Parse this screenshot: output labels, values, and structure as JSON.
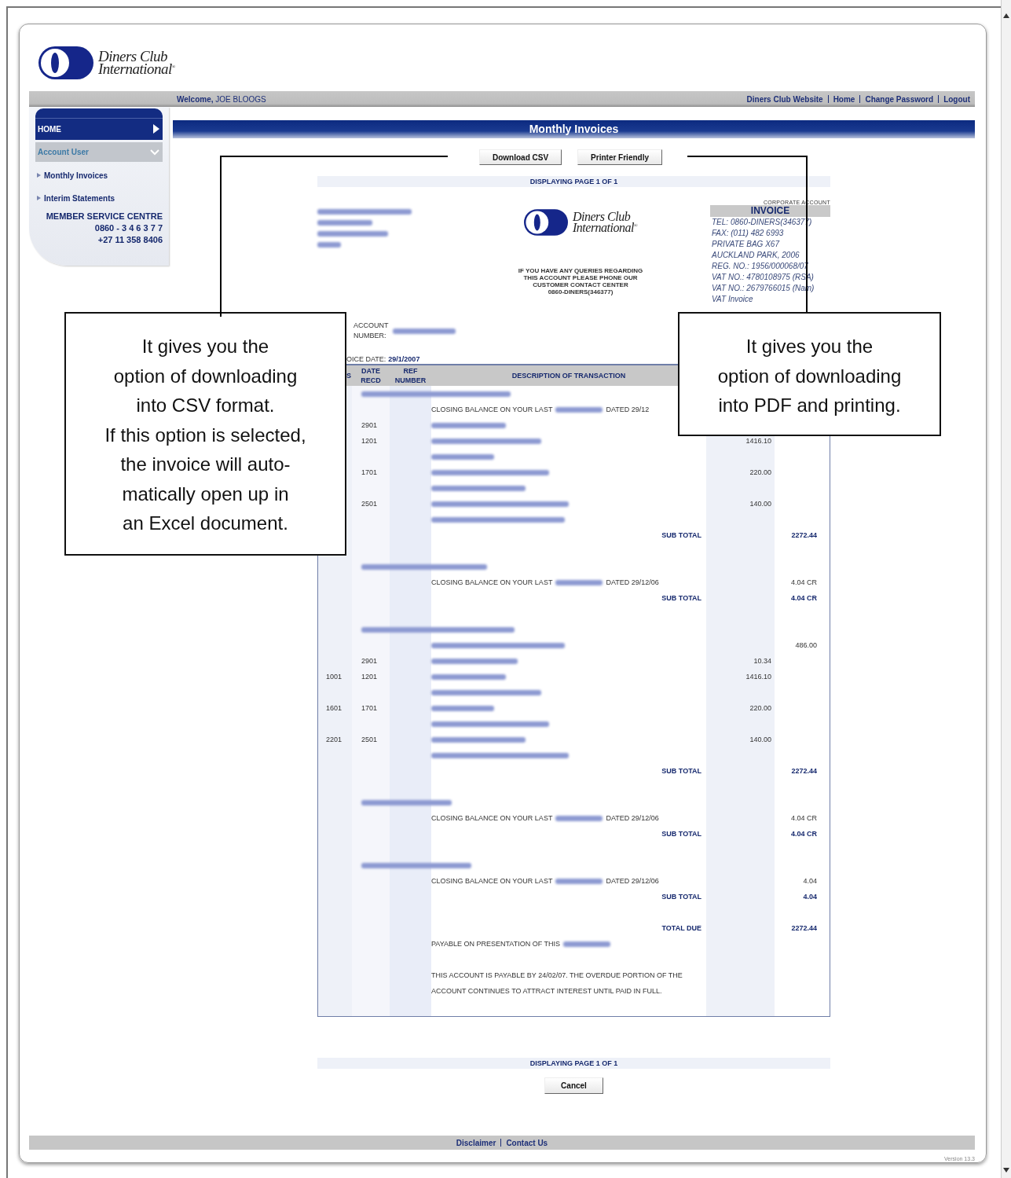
{
  "header": {
    "logo": {
      "line_1": "Diners Club",
      "line_2": "International$^{®}$"
    }
  },
  "top_bar": {
    "welcome": "**Welcome,** JOE BLOOGS",
    "links": [
      "Diners Club Website",
      "Home",
      "Change Password",
      "Logout"
    ]
  },
  "sidebar": {
    "items": [
      {
        "label": "HOME",
        "kind": "home"
      },
      {
        "label": "Account User",
        "kind": "section",
        "expanded": true
      },
      {
        "label": "Monthly Invoices",
        "kind": "link"
      },
      {
        "label": "Interim Statements",
        "kind": "link"
      }
    ],
    "service_centre": [
      "MEMBER SERVICE CENTRE",
      "0860 - 3 4 6 3 7 7",
      "+27 11 358 8406"
    ]
  },
  "page_title": "Monthly Invoices",
  "buttons": [
    "Download CSV",
    "Printer Friendly"
  ],
  "invoice": {
    "paging_top": "DISPLAYING PAGE 1 OF 1",
    "address": [
      {
        "kind": "redacted"
      },
      {
        "kind": "redacted"
      },
      {
        "kind": "redacted"
      },
      {
        "kind": "redacted"
      }
    ],
    "logo": {
      "line_1": "Diners Club",
      "line_2": "International$^{®}$"
    },
    "queries": [
      "IF YOU HAVE ANY QUERIES REGARDING",
      "THIS ACCOUNT PLEASE PHONE OUR",
      "CUSTOMER CONTACT CENTER",
      "0860-DINERS(346377)"
    ],
    "issuer": {
      "account_type": "CORPORATE ACCOUNT",
      "title": "INVOICE",
      "lines": [
        "TEL: 0860-DINERS(346377)",
        "FAX: (011) 482 6993",
        "PRIVATE BAG X67",
        "AUCKLAND PARK, 2006",
        "REG. NO.: 1956/000068/07",
        "VAT NO.: 4780108975 (RSA)",
        "VAT NO.: 2679766015 (Nam)",
        "VAT Invoice"
      ]
    },
    "account_number": {
      "label": "ACCOUNT NUMBER:",
      "value": {
        "kind": "redacted"
      }
    },
    "invoice_date": {
      "label": "OICE DATE:",
      "value": "29/1/2007"
    },
    "columns": [
      "S",
      "DATE RECD",
      "REF NUMBER",
      "DESCRIPTION OF TRANSACTION"
    ],
    "rows": [
      {
        "kind": "account"
      },
      {
        "kind": "line",
        "description": [
          {
            "text": "CLOSING BALANCE ON YOUR LAST"
          },
          {
            "kind": "redacted"
          },
          {
            "text": "DATED 29/12"
          }
        ]
      },
      {
        "kind": "line",
        "date_recd": "2901",
        "description": [
          {
            "kind": "redacted"
          }
        ]
      },
      {
        "kind": "line",
        "date_recd": "1201",
        "description": [
          {
            "kind": "redacted"
          }
        ],
        "column_5": "1416.10"
      },
      {
        "kind": "line",
        "description": [
          {
            "kind": "redacted"
          }
        ]
      },
      {
        "kind": "line",
        "date_recd": "1701",
        "description": [
          {
            "kind": "redacted"
          }
        ],
        "column_5": "220.00"
      },
      {
        "kind": "line",
        "description": [
          {
            "kind": "redacted"
          }
        ]
      },
      {
        "kind": "line",
        "date_recd": "2501",
        "description": [
          {
            "kind": "redacted"
          }
        ],
        "column_5": "140.00"
      },
      {
        "kind": "line",
        "description": [
          {
            "kind": "redacted"
          }
        ]
      },
      {
        "kind": "subtotal",
        "label": "SUB TOTAL",
        "column_6": "2272.44"
      },
      {
        "kind": "blank"
      },
      {
        "kind": "account"
      },
      {
        "kind": "line",
        "description": [
          {
            "text": "CLOSING BALANCE ON YOUR LAST"
          },
          {
            "kind": "redacted"
          },
          {
            "text": "DATED 29/12/06"
          }
        ],
        "column_6": "4.04 CR"
      },
      {
        "kind": "subtotal",
        "label": "SUB TOTAL",
        "column_6": "4.04 CR"
      },
      {
        "kind": "blank"
      },
      {
        "kind": "account"
      },
      {
        "kind": "line",
        "description": [
          {
            "kind": "redacted"
          }
        ],
        "column_6": "486.00"
      },
      {
        "kind": "line",
        "date_recd": "2901",
        "description": [
          {
            "kind": "redacted"
          }
        ],
        "column_5": "10.34"
      },
      {
        "kind": "line",
        "column_1": "1001",
        "date_recd": "1201",
        "description": [
          {
            "kind": "redacted"
          }
        ],
        "column_5": "1416.10"
      },
      {
        "kind": "line",
        "description": [
          {
            "kind": "redacted"
          }
        ]
      },
      {
        "kind": "line",
        "column_1": "1601",
        "date_recd": "1701",
        "description": [
          {
            "kind": "redacted"
          }
        ],
        "column_5": "220.00"
      },
      {
        "kind": "line",
        "description": [
          {
            "kind": "redacted"
          }
        ]
      },
      {
        "kind": "line",
        "column_1": "2201",
        "date_recd": "2501",
        "description": [
          {
            "kind": "redacted"
          }
        ],
        "column_5": "140.00"
      },
      {
        "kind": "line",
        "description": [
          {
            "kind": "redacted"
          }
        ]
      },
      {
        "kind": "subtotal",
        "label": "SUB TOTAL",
        "column_6": "2272.44"
      },
      {
        "kind": "blank"
      },
      {
        "kind": "account"
      },
      {
        "kind": "line",
        "description": [
          {
            "text": "CLOSING BALANCE ON YOUR LAST"
          },
          {
            "kind": "redacted"
          },
          {
            "text": "DATED 29/12/06"
          }
        ],
        "column_6": "4.04 CR"
      },
      {
        "kind": "subtotal",
        "label": "SUB TOTAL",
        "column_6": "4.04 CR"
      },
      {
        "kind": "blank"
      },
      {
        "kind": "account"
      },
      {
        "kind": "line",
        "description": [
          {
            "text": "CLOSING BALANCE ON YOUR LAST"
          },
          {
            "kind": "redacted"
          },
          {
            "text": "DATED 29/12/06"
          }
        ],
        "column_6": "4.04"
      },
      {
        "kind": "subtotal",
        "label": "SUB TOTAL",
        "column_6": "4.04"
      },
      {
        "kind": "blank"
      },
      {
        "kind": "subtotal",
        "label": "TOTAL DUE",
        "column_6": "2272.44"
      },
      {
        "kind": "line",
        "description": [
          {
            "text": "PAYABLE ON PRESENTATION OF THIS"
          },
          {
            "kind": "redacted"
          }
        ]
      },
      {
        "kind": "blank"
      },
      {
        "kind": "line",
        "description": [
          {
            "text": "THIS ACCOUNT IS PAYABLE BY 24/02/07. THE OVERDUE PORTION OF THE ACCOUNT CONTINUES TO ATTRACT INTEREST UNTIL PAID IN FULL."
          }
        ]
      }
    ],
    "paging_bottom": "DISPLAYING PAGE 1 OF 1"
  },
  "cancel_button": "Cancel",
  "footer": {
    "links": [
      "Disclaimer",
      "Contact Us"
    ],
    "version": "Version 13.3"
  },
  "callouts": [
    {
      "lines": [
        "It gives you the",
        "option of downloading",
        "into CSV format.",
        "If this option is selected,",
        "the invoice will auto-",
        "matically open up in",
        "an Excel document."
      ]
    },
    {
      "lines": [
        "It gives you the",
        "option of downloading",
        "into PDF and printing."
      ]
    }
  ]
}
